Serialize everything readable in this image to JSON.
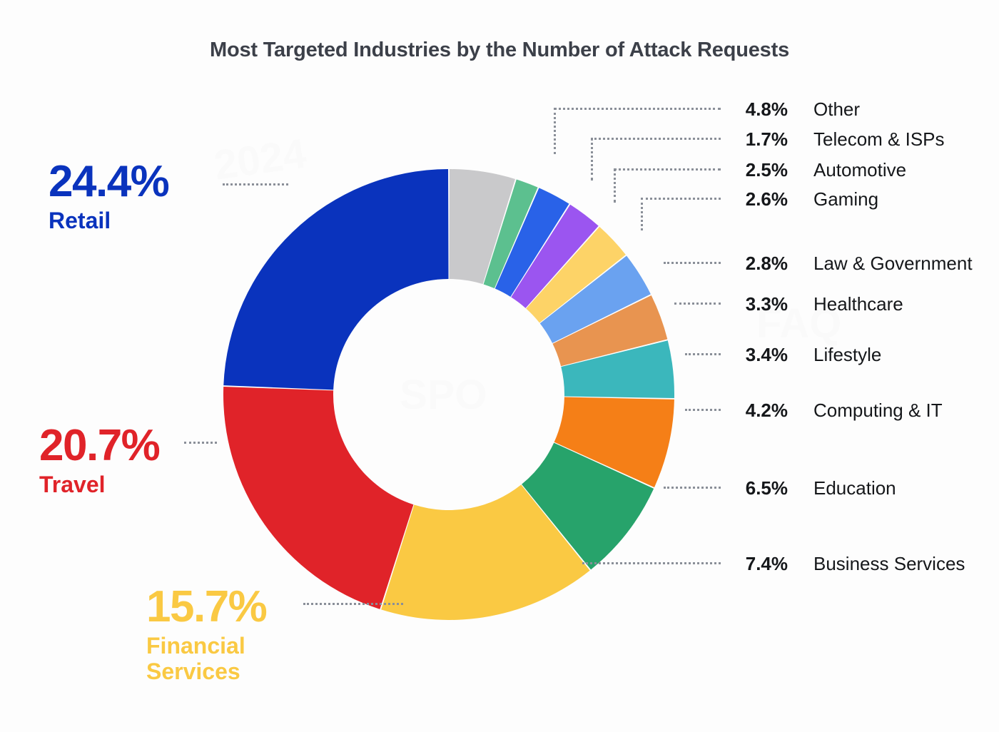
{
  "chart_data": {
    "type": "pie",
    "variant": "donut",
    "title": "Most Targeted Industries by the Number of Attack Requests",
    "unit": "%",
    "legend_position": "callout-labels",
    "categories": [
      "Other",
      "Telecom & ISPs",
      "Automotive",
      "Gaming",
      "Law & Government",
      "Healthcare",
      "Lifestyle",
      "Computing & IT",
      "Education",
      "Business Services",
      "Financial Services",
      "Travel",
      "Retail"
    ],
    "values": [
      4.8,
      1.7,
      2.5,
      2.6,
      2.8,
      3.3,
      3.4,
      4.2,
      6.5,
      7.4,
      15.7,
      20.7,
      24.4
    ],
    "colors": [
      "#C9C9CB",
      "#5CC08F",
      "#2962E8",
      "#9B55F0",
      "#FDD367",
      "#6AA2F0",
      "#E89450",
      "#3BB7BC",
      "#F57F17",
      "#27A36B",
      "#FAC943",
      "#E02329",
      "#0A33BD"
    ],
    "start_angle_deg": 0,
    "direction": "clockwise",
    "slices": [
      {
        "label": "Other",
        "pct": "4.8%",
        "value": 4.8,
        "color": "#C9C9CB"
      },
      {
        "label": "Telecom & ISPs",
        "pct": "1.7%",
        "value": 1.7,
        "color": "#5CC08F"
      },
      {
        "label": "Automotive",
        "pct": "2.5%",
        "value": 2.5,
        "color": "#2962E8"
      },
      {
        "label": "Gaming",
        "pct": "2.6%",
        "value": 2.6,
        "color": "#9B55F0"
      },
      {
        "label": "Law & Government",
        "pct": "2.8%",
        "value": 2.8,
        "color": "#FDD367"
      },
      {
        "label": "Healthcare",
        "pct": "3.3%",
        "value": 3.3,
        "color": "#6AA2F0"
      },
      {
        "label": "Lifestyle",
        "pct": "3.4%",
        "value": 3.4,
        "color": "#E89450"
      },
      {
        "label": "Computing & IT",
        "pct": "4.2%",
        "value": 4.2,
        "color": "#3BB7BC"
      },
      {
        "label": "Education",
        "pct": "6.5%",
        "value": 6.5,
        "color": "#F57F17"
      },
      {
        "label": "Business Services",
        "pct": "7.4%",
        "value": 7.4,
        "color": "#27A36B"
      },
      {
        "label": "Financial Services",
        "pct": "15.7%",
        "value": 15.7,
        "color": "#FAC943"
      },
      {
        "label": "Travel",
        "pct": "20.7%",
        "value": 20.7,
        "color": "#E02329"
      },
      {
        "label": "Retail",
        "pct": "24.4%",
        "value": 24.4,
        "color": "#0A33BD"
      }
    ]
  },
  "header": {
    "title": "Most Targeted Industries by the Number of Attack Requests"
  },
  "legend": {
    "rows": [
      {
        "pct": "4.8%",
        "name": "Other"
      },
      {
        "pct": "1.7%",
        "name": "Telecom & ISPs"
      },
      {
        "pct": "2.5%",
        "name": "Automotive"
      },
      {
        "pct": "2.6%",
        "name": "Gaming"
      },
      {
        "pct": "2.8%",
        "name": "Law & Government"
      },
      {
        "pct": "3.3%",
        "name": "Healthcare"
      },
      {
        "pct": "3.4%",
        "name": "Lifestyle"
      },
      {
        "pct": "4.2%",
        "name": "Computing & IT"
      },
      {
        "pct": "6.5%",
        "name": "Education"
      },
      {
        "pct": "7.4%",
        "name": "Business Services"
      }
    ]
  },
  "callouts": {
    "retail": {
      "pct": "24.4%",
      "name": "Retail",
      "color": "#0A33BD"
    },
    "travel": {
      "pct": "20.7%",
      "name": "Travel",
      "color": "#E02329"
    },
    "financial": {
      "pct": "15.7%",
      "name_line1": "Financial",
      "name_line2": "Services",
      "color": "#FAC943"
    }
  }
}
